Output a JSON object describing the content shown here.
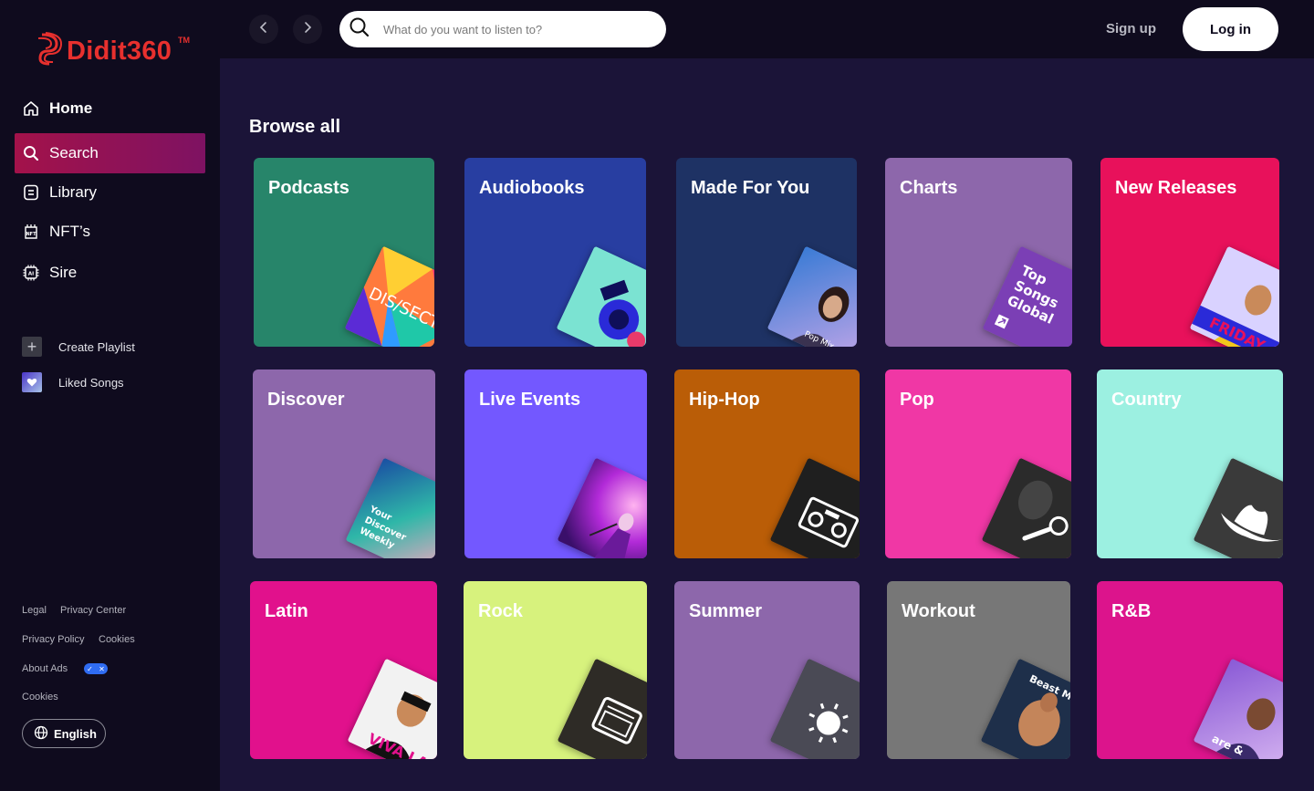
{
  "brand": {
    "name": "Didit360",
    "tm": "TM",
    "color": "#e8302e"
  },
  "nav": [
    {
      "label": "Home",
      "icon": "home-icon"
    },
    {
      "label": "Search",
      "icon": "search-icon"
    },
    {
      "label": "Library",
      "icon": "library-icon"
    },
    {
      "label": "NFT’s",
      "icon": "nft-icon"
    },
    {
      "label": "Sire",
      "icon": "ai-chip-icon"
    }
  ],
  "library": {
    "create_playlist": "Create Playlist",
    "liked_songs": "Liked Songs"
  },
  "footer": {
    "legal": "Legal",
    "privacy_center": "Privacy Center",
    "privacy_policy": "Privacy Policy",
    "cookies": "Cookies",
    "about_ads": "About Ads",
    "cookies2": "Cookies",
    "language": "English"
  },
  "topbar": {
    "search_placeholder": "What do you want to listen to?",
    "signup": "Sign up",
    "login": "Log in"
  },
  "main": {
    "title": "Browse all",
    "categories": [
      {
        "label": "Podcasts",
        "color": "#27856a",
        "art_text": "DIS/SECT"
      },
      {
        "label": "Audiobooks",
        "color": "#283ea1",
        "art_text": ""
      },
      {
        "label": "Made For You",
        "color": "#1e3264",
        "art_text": "Pop Mix"
      },
      {
        "label": "Charts",
        "color": "#8d67ab",
        "art_text": "Top Songs Global"
      },
      {
        "label": "New Releases",
        "color": "#e8115b",
        "art_text": "FRIDAY"
      },
      {
        "label": "Discover",
        "color": "#8d67ab",
        "art_text": "Your Discover Weekly"
      },
      {
        "label": "Live Events",
        "color": "#7358ff",
        "art_text": ""
      },
      {
        "label": "Hip-Hop",
        "color": "#ba5d07",
        "art_text": ""
      },
      {
        "label": "Pop",
        "color": "#f037a5",
        "art_text": ""
      },
      {
        "label": "Country",
        "color": "#9cf0e1",
        "art_text": ""
      },
      {
        "label": "Latin",
        "color": "#e1118c",
        "art_text": "VIVA LATINO"
      },
      {
        "label": "Rock",
        "color": "#d7f27d",
        "art_text": ""
      },
      {
        "label": "Summer",
        "color": "#8d67ab",
        "art_text": ""
      },
      {
        "label": "Workout",
        "color": "#777777",
        "art_text": "Beast Mode"
      },
      {
        "label": "R&B",
        "color": "#dc148c",
        "art_text": "are &"
      }
    ]
  }
}
